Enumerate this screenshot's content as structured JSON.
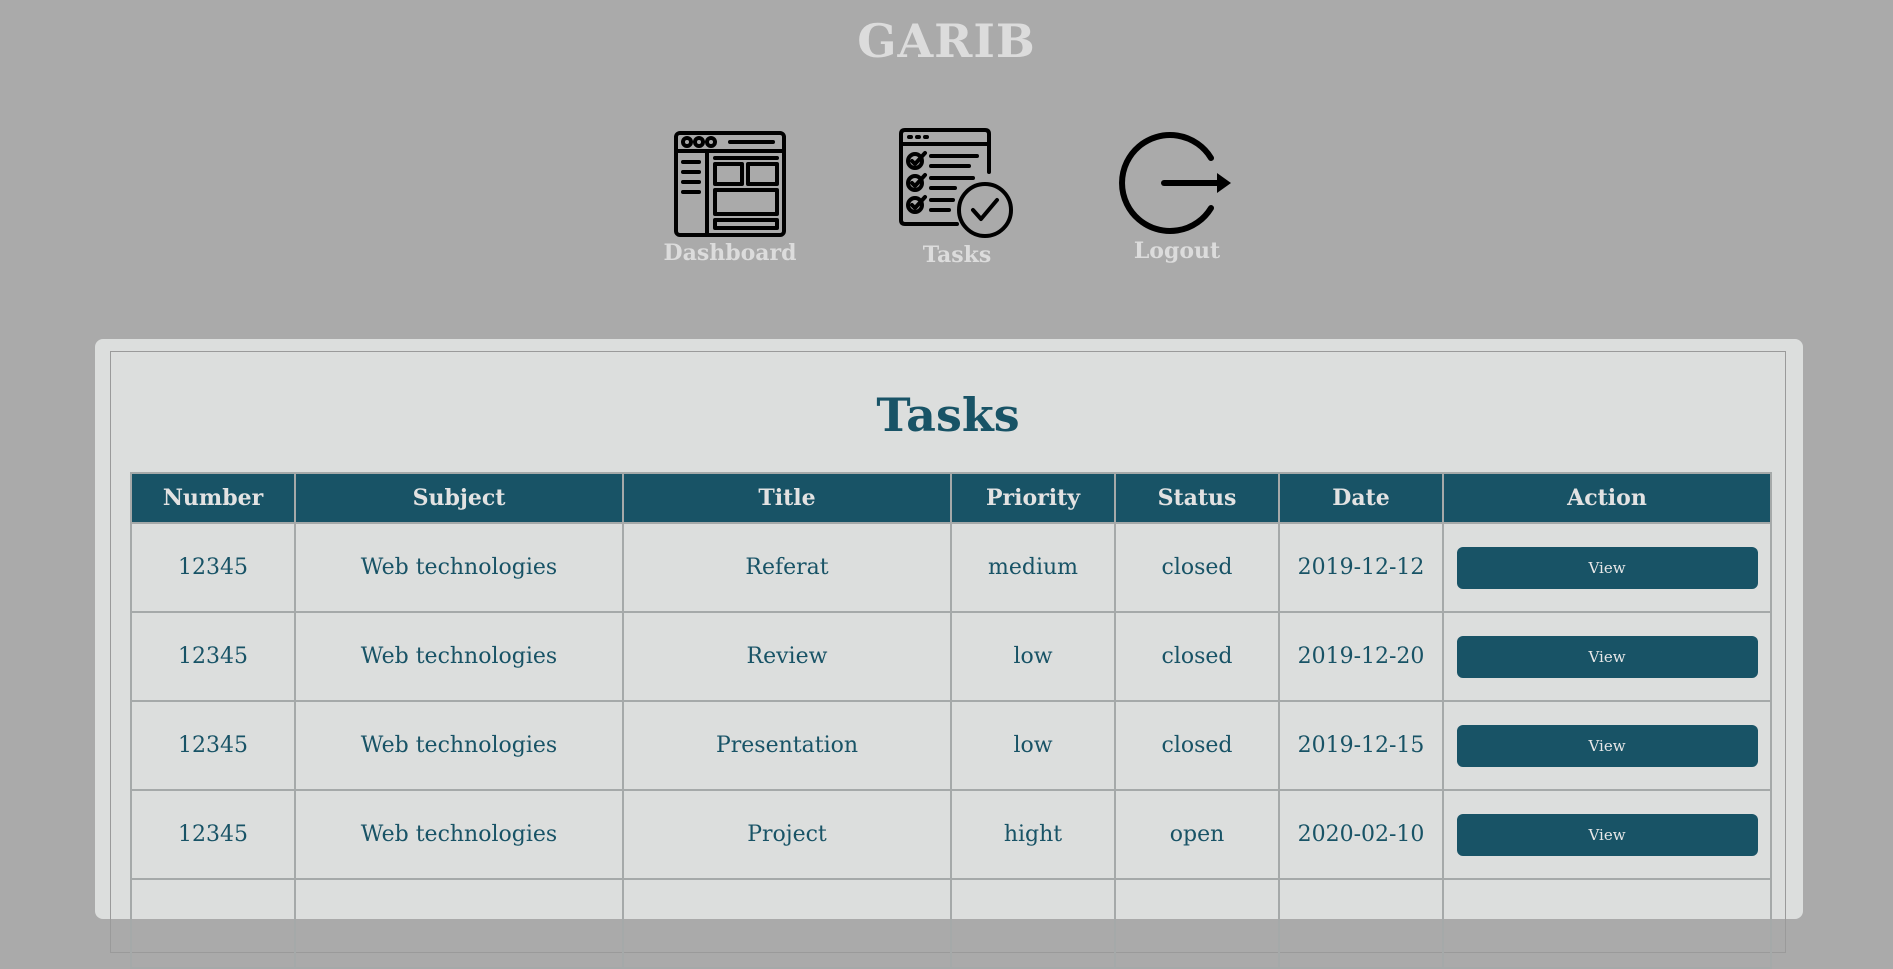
{
  "brand": "GARIB",
  "nav": {
    "dashboard": "Dashboard",
    "tasks": "Tasks",
    "logout": "Logout"
  },
  "page_title": "Tasks",
  "table": {
    "headers": [
      "Number",
      "Subject",
      "Title",
      "Priority",
      "Status",
      "Date",
      "Action"
    ],
    "rows": [
      {
        "number": "12345",
        "subject": "Web technologies",
        "title": "Referat",
        "priority": "medium",
        "status": "closed",
        "date": "2019-12-12",
        "action": "View"
      },
      {
        "number": "12345",
        "subject": "Web technologies",
        "title": "Review",
        "priority": "low",
        "status": "closed",
        "date": "2019-12-20",
        "action": "View"
      },
      {
        "number": "12345",
        "subject": "Web technologies",
        "title": "Presentation",
        "priority": "low",
        "status": "closed",
        "date": "2019-12-15",
        "action": "View"
      },
      {
        "number": "12345",
        "subject": "Web technologies",
        "title": "Project",
        "priority": "hight",
        "status": "open",
        "date": "2020-02-10",
        "action": "View"
      },
      {
        "number": "",
        "subject": "",
        "title": "",
        "priority": "",
        "status": "",
        "date": "",
        "action": ""
      }
    ]
  },
  "colors": {
    "background": "#aaaaaa",
    "accent": "#185366",
    "panel": "#dcdedd",
    "nav_text": "#dcdcdc"
  },
  "icons": {
    "dashboard": "dashboard-icon",
    "tasks": "checklist-icon",
    "logout": "logout-icon"
  }
}
